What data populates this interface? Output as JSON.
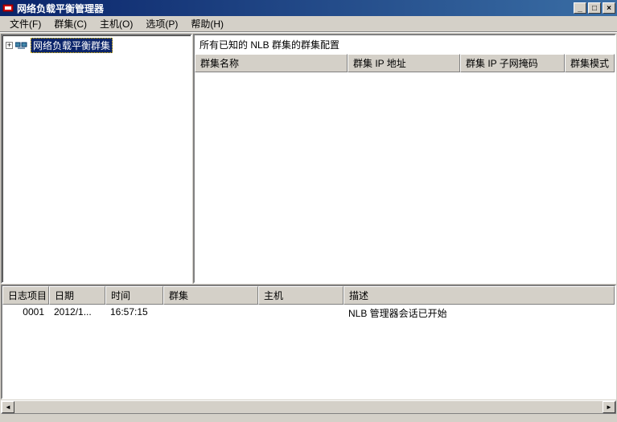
{
  "window": {
    "title": "网络负载平衡管理器"
  },
  "menu": {
    "file": "文件(F)",
    "cluster": "群集(C)",
    "host": "主机(O)",
    "options": "选项(P)",
    "help": "帮助(H)"
  },
  "tree": {
    "root": "网络负载平衡群集"
  },
  "right": {
    "header": "所有已知的 NLB 群集的群集配置",
    "cols": {
      "name": "群集名称",
      "ip": "群集 IP 地址",
      "mask": "群集 IP 子网掩码",
      "mode": "群集模式"
    }
  },
  "log": {
    "cols": {
      "item": "日志项目",
      "date": "日期",
      "time": "时间",
      "cluster": "群集",
      "host": "主机",
      "desc": "描述"
    },
    "row1": {
      "item": "0001",
      "date": "2012/1...",
      "time": "16:57:15",
      "cluster": "",
      "host": "",
      "desc": "NLB 管理器会话已开始"
    }
  }
}
